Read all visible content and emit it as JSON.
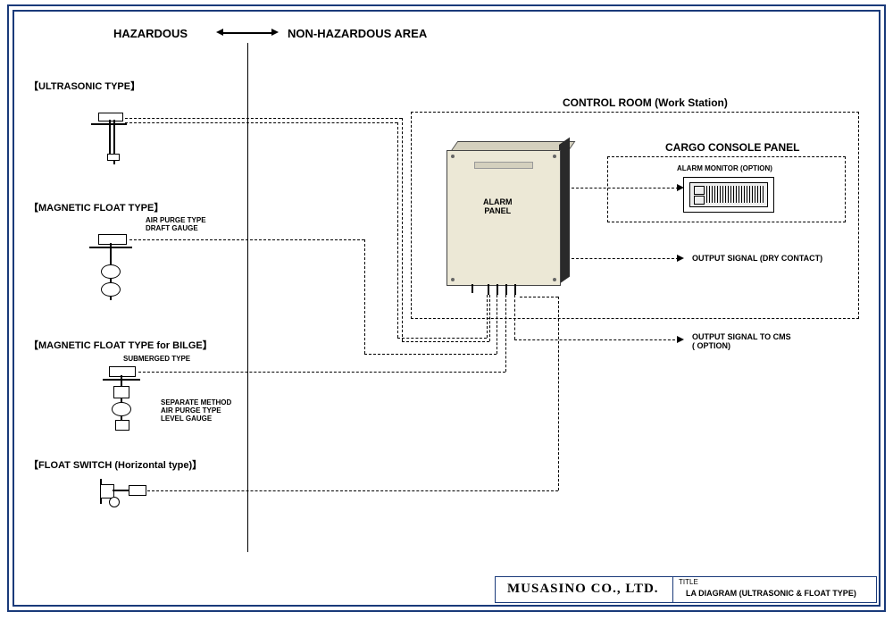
{
  "header": {
    "hazardous": "HAZARDOUS",
    "nonhazardous": "NON-HAZARDOUS AREA"
  },
  "sensors": {
    "ultrasonic": "【ULTRASONIC TYPE】",
    "magfloat": "【MAGNETIC FLOAT TYPE】",
    "magfloat_note": "AIR PURGE TYPE\nDRAFT GAUGE",
    "magfloat_bilge": "【MAGNETIC FLOAT TYPE for BILGE】",
    "magfloat_bilge_note1": "SUBMERGED TYPE",
    "magfloat_bilge_note2": "SEPARATE METHOD\nAIR PURGE TYPE\nLEVEL GAUGE",
    "floatswitch": "【FLOAT SWITCH (Horizontal type)】"
  },
  "room": {
    "control_room": "CONTROL ROOM (Work Station)",
    "alarm_panel": "ALARM\nPANEL",
    "cargo_console": "CARGO CONSOLE PANEL",
    "alarm_monitor": "ALARM MONITOR (OPTION)"
  },
  "outputs": {
    "dry_contact": "OUTPUT SIGNAL (DRY CONTACT)",
    "cms": "OUTPUT SIGNAL TO CMS\n( OPTION)"
  },
  "titleblock": {
    "company": "MUSASINO CO., LTD.",
    "title_label": "TITLE",
    "title_value": "LA DIAGRAM (ULTRASONIC & FLOAT TYPE)"
  },
  "chart_data": {
    "type": "diagram",
    "zones": [
      "HAZARDOUS",
      "NON-HAZARDOUS AREA"
    ],
    "boundary_between_zones": true,
    "sensors_in_hazardous": [
      {
        "name": "ULTRASONIC TYPE"
      },
      {
        "name": "MAGNETIC FLOAT TYPE",
        "note": "AIR PURGE TYPE DRAFT GAUGE"
      },
      {
        "name": "MAGNETIC FLOAT TYPE for BILGE",
        "note": "SUBMERGED TYPE / SEPARATE METHOD AIR PURGE TYPE LEVEL GAUGE"
      },
      {
        "name": "FLOAT SWITCH (Horizontal type)"
      }
    ],
    "control_room_components": [
      "ALARM PANEL",
      "CARGO CONSOLE PANEL",
      "ALARM MONITOR (OPTION)"
    ],
    "outputs": [
      "OUTPUT SIGNAL (DRY CONTACT)",
      "OUTPUT SIGNAL TO CMS (OPTION)"
    ],
    "title": "LA DIAGRAM (ULTRASONIC & FLOAT TYPE)",
    "company": "MUSASINO CO., LTD."
  }
}
